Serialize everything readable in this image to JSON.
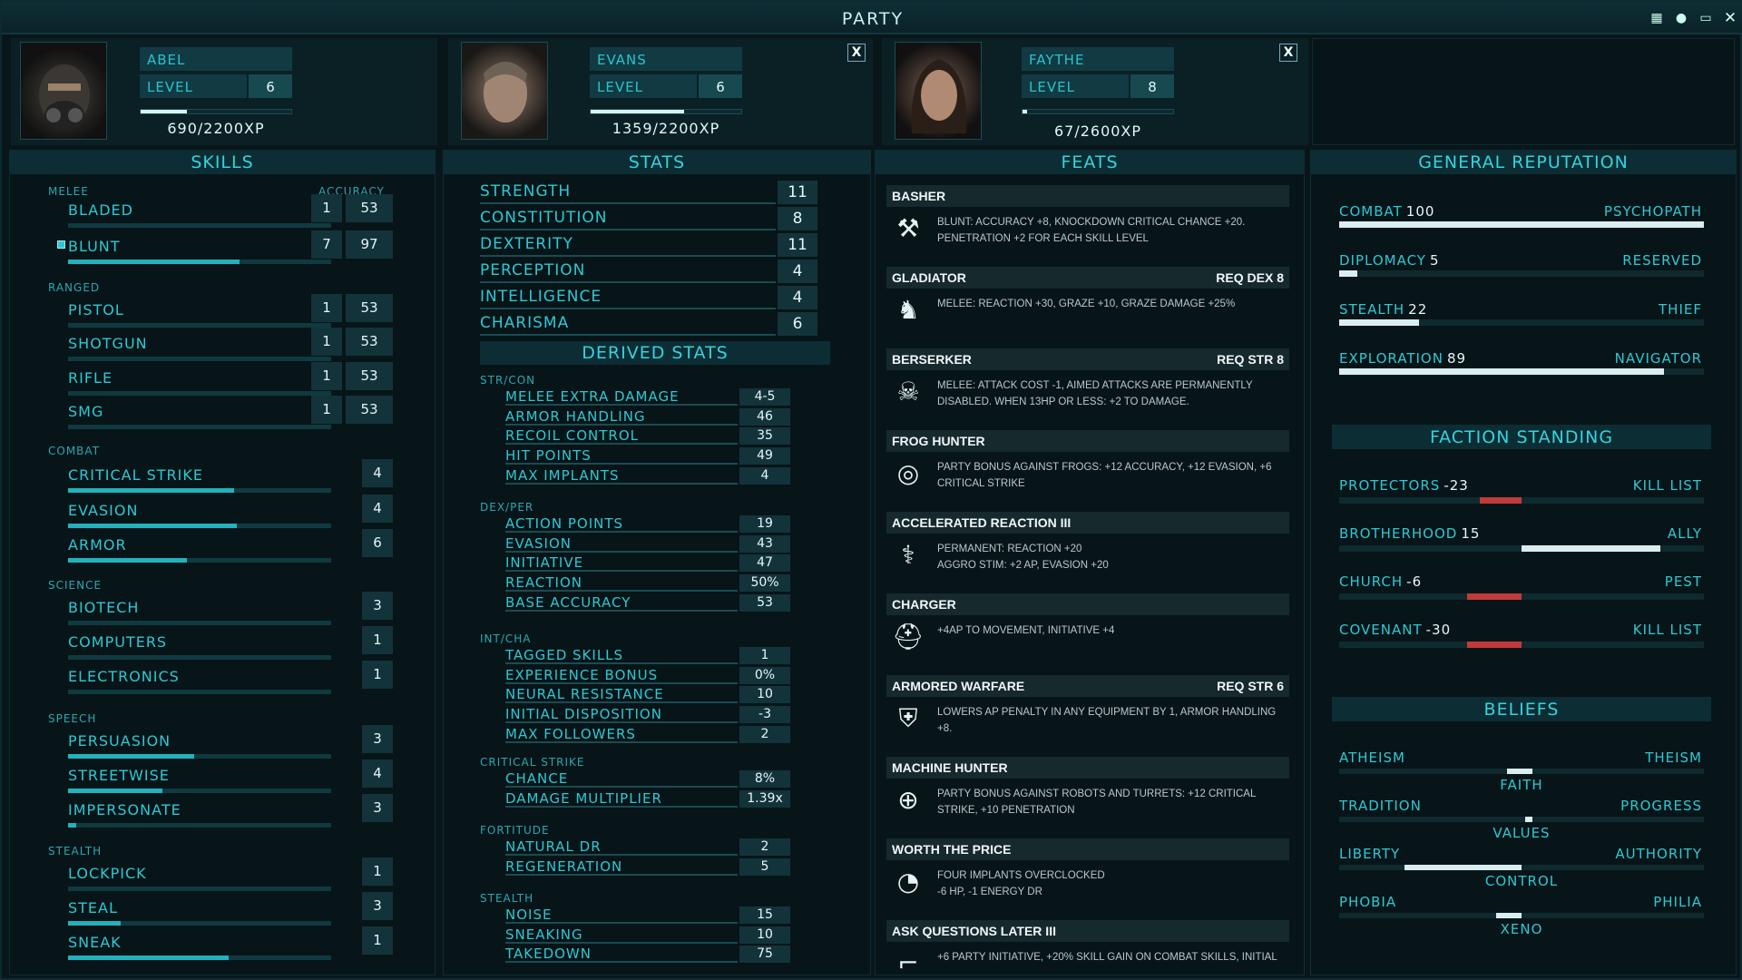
{
  "title": "PARTY",
  "chars": [
    {
      "name": "ABEL",
      "level_label": "LEVEL",
      "level": "6",
      "xp": "690/2200XP",
      "xp_frac": 0.31
    },
    {
      "name": "EVANS",
      "level_label": "LEVEL",
      "level": "6",
      "xp": "1359/2200XP",
      "xp_frac": 0.62
    },
    {
      "name": "FAYTHE",
      "level_label": "LEVEL",
      "level": "8",
      "xp": "67/2600XP",
      "xp_frac": 0.03
    }
  ],
  "close_label": "X",
  "headers": {
    "skills": "SKILLS",
    "stats": "STATS",
    "feats": "FEATS",
    "rep": "GENERAL REPUTATION",
    "derived": "DERIVED STATS",
    "faction": "FACTION STANDING",
    "beliefs": "BELIEFS"
  },
  "skills": {
    "melee": "MELEE",
    "accuracy": "ACCURACY",
    "ranged": "RANGED",
    "combat": "COMBAT",
    "science": "SCIENCE",
    "speech": "SPEECH",
    "stealth": "STEALTH",
    "items": [
      {
        "label": "BLADED",
        "lvl": "1",
        "acc": "53",
        "frac": 0
      },
      {
        "label": "BLUNT",
        "lvl": "7",
        "acc": "97",
        "frac": 0.65
      },
      {
        "label": "PISTOL",
        "lvl": "1",
        "acc": "53",
        "frac": 0
      },
      {
        "label": "SHOTGUN",
        "lvl": "1",
        "acc": "53",
        "frac": 0
      },
      {
        "label": "RIFLE",
        "lvl": "1",
        "acc": "53",
        "frac": 0
      },
      {
        "label": "SMG",
        "lvl": "1",
        "acc": "53",
        "frac": 0
      },
      {
        "label": "CRITICAL STRIKE",
        "lvl": "4",
        "frac": 0.63
      },
      {
        "label": "EVASION",
        "lvl": "4",
        "frac": 0.64
      },
      {
        "label": "ARMOR",
        "lvl": "6",
        "frac": 0.45
      },
      {
        "label": "BIOTECH",
        "lvl": "3",
        "frac": 0
      },
      {
        "label": "COMPUTERS",
        "lvl": "1",
        "frac": 0
      },
      {
        "label": "ELECTRONICS",
        "lvl": "1",
        "frac": 0
      },
      {
        "label": "PERSUASION",
        "lvl": "3",
        "frac": 0.48
      },
      {
        "label": "STREETWISE",
        "lvl": "4",
        "frac": 0.36
      },
      {
        "label": "IMPERSONATE",
        "lvl": "3",
        "frac": 0.03
      },
      {
        "label": "LOCKPICK",
        "lvl": "1",
        "frac": 0
      },
      {
        "label": "STEAL",
        "lvl": "3",
        "frac": 0.2
      },
      {
        "label": "SNEAK",
        "lvl": "1",
        "frac": 0.61
      }
    ]
  },
  "stats": [
    {
      "label": "STRENGTH",
      "value": "11"
    },
    {
      "label": "CONSTITUTION",
      "value": "8"
    },
    {
      "label": "DEXTERITY",
      "value": "11"
    },
    {
      "label": "PERCEPTION",
      "value": "4"
    },
    {
      "label": "INTELLIGENCE",
      "value": "4"
    },
    {
      "label": "CHARISMA",
      "value": "6"
    }
  ],
  "derived": [
    {
      "group": "STR/CON",
      "items": [
        {
          "label": "MELEE EXTRA DAMAGE",
          "value": "4-5"
        },
        {
          "label": "ARMOR HANDLING",
          "value": "46"
        },
        {
          "label": "RECOIL CONTROL",
          "value": "35"
        },
        {
          "label": "HIT POINTS",
          "value": "49"
        },
        {
          "label": "MAX IMPLANTS",
          "value": "4"
        }
      ]
    },
    {
      "group": "DEX/PER",
      "items": [
        {
          "label": "ACTION POINTS",
          "value": "19"
        },
        {
          "label": "EVASION",
          "value": "43"
        },
        {
          "label": "INITIATIVE",
          "value": "47"
        },
        {
          "label": "REACTION",
          "value": "50%"
        },
        {
          "label": "BASE ACCURACY",
          "value": "53"
        }
      ]
    },
    {
      "group": "INT/CHA",
      "items": [
        {
          "label": "TAGGED SKILLS",
          "value": "1"
        },
        {
          "label": "EXPERIENCE BONUS",
          "value": "0%"
        },
        {
          "label": "NEURAL RESISTANCE",
          "value": "10"
        },
        {
          "label": "INITIAL DISPOSITION",
          "value": "-3"
        },
        {
          "label": "MAX FOLLOWERS",
          "value": "2"
        }
      ]
    },
    {
      "group": "CRITICAL STRIKE",
      "items": [
        {
          "label": "CHANCE",
          "value": "8%"
        },
        {
          "label": "DAMAGE MULTIPLIER",
          "value": "1.39x"
        }
      ]
    },
    {
      "group": "FORTITUDE",
      "items": [
        {
          "label": "NATURAL DR",
          "value": "2"
        },
        {
          "label": "REGENERATION",
          "value": "5"
        }
      ]
    },
    {
      "group": "STEALTH",
      "items": [
        {
          "label": "NOISE",
          "value": "15"
        },
        {
          "label": "SNEAKING",
          "value": "10"
        },
        {
          "label": "TAKEDOWN",
          "value": "75"
        }
      ]
    }
  ],
  "feats": [
    {
      "name": "BASHER",
      "req": "",
      "icon": "hammer-wrench-icon",
      "glyph": "⚒",
      "desc": "BLUNT: ACCURACY +8, KNOCKDOWN CRITICAL CHANCE +20. PENETRATION +2 FOR EACH SKILL LEVEL"
    },
    {
      "name": "GLADIATOR",
      "req": "REQ DEX 8",
      "icon": "gladiator-icon",
      "glyph": "♞",
      "desc": "MELEE: REACTION +30, GRAZE +10, GRAZE DAMAGE +25%"
    },
    {
      "name": "BERSERKER",
      "req": "REQ STR 8",
      "icon": "skull-axes-icon",
      "glyph": "☠",
      "desc": "MELEE: ATTACK COST -1, AIMED ATTACKS ARE PERMANENTLY DISABLED. WHEN 13HP OR LESS: +2 TO DAMAGE."
    },
    {
      "name": "FROG HUNTER",
      "req": "",
      "icon": "frog-target-icon",
      "glyph": "◎",
      "desc": "PARTY BONUS AGAINST FROGS: +12 ACCURACY, +12 EVASION, +6 CRITICAL STRIKE"
    },
    {
      "name": "ACCELERATED REACTION III",
      "req": "",
      "icon": "dna-icon",
      "glyph": "⚕",
      "desc": "PERMANENT: REACTION +20\nAGGRO STIM: +2 AP, EVASION +20"
    },
    {
      "name": "CHARGER",
      "req": "",
      "icon": "helmet-icon",
      "glyph": "⛑",
      "desc": "+4AP TO MOVEMENT, INITIATIVE +4"
    },
    {
      "name": "ARMORED WARFARE",
      "req": "REQ STR 6",
      "icon": "armor-icon",
      "glyph": "⛨",
      "desc": "LOWERS AP PENALTY IN ANY EQUIPMENT BY 1, ARMOR HANDLING +8."
    },
    {
      "name": "MACHINE HUNTER",
      "req": "",
      "icon": "robot-target-icon",
      "glyph": "⊕",
      "desc": "PARTY BONUS AGAINST ROBOTS AND TURRETS: +12 CRITICAL STRIKE, +10 PENETRATION"
    },
    {
      "name": "WORTH THE PRICE",
      "req": "",
      "icon": "gauge-icon",
      "glyph": "◔",
      "desc": "FOUR IMPLANTS OVERCLOCKED\n-6 HP, -1 ENERGY DR"
    },
    {
      "name": "ASK QUESTIONS LATER III",
      "req": "",
      "icon": "gun-icon",
      "glyph": "⌐",
      "desc": "+6 PARTY INITIATIVE, +20% SKILL GAIN ON COMBAT SKILLS, INITIAL"
    }
  ],
  "reputation": [
    {
      "left": "COMBAT",
      "value": "100",
      "right": "PSYCHOPATH",
      "frac": 1.0
    },
    {
      "left": "DIPLOMACY",
      "value": "5",
      "right": "RESERVED",
      "frac": 0.05
    },
    {
      "left": "STEALTH",
      "value": "22",
      "right": "THIEF",
      "frac": 0.22
    },
    {
      "left": "EXPLORATION",
      "value": "89",
      "right": "NAVIGATOR",
      "frac": 0.89
    }
  ],
  "factions": [
    {
      "left": "PROTECTORS",
      "value": "-23",
      "right": "KILL LIST",
      "frac": -0.23,
      "color": "#c03b3b"
    },
    {
      "left": "BROTHERHOOD",
      "value": "15",
      "right": "ALLY",
      "frac": 0.76,
      "color": "#d8eef0"
    },
    {
      "left": "CHURCH",
      "value": "-6",
      "right": "PEST",
      "frac": -0.06,
      "color": "#c03b3b"
    },
    {
      "left": "COVENANT",
      "value": "-30",
      "right": "KILL LIST",
      "frac": -0.3,
      "color": "#c03b3b"
    }
  ],
  "beliefs": [
    {
      "left": "ATHEISM",
      "right": "THEISM",
      "label": "FAITH",
      "pos": 0.46,
      "width": 0.07
    },
    {
      "left": "TRADITION",
      "right": "PROGRESS",
      "label": "VALUES",
      "pos": 0.51,
      "width": 0.02
    },
    {
      "left": "LIBERTY",
      "right": "AUTHORITY",
      "label": "CONTROL",
      "pos": 0.18,
      "width": 0.32
    },
    {
      "left": "PHOBIA",
      "right": "PHILIA",
      "label": "XENO",
      "pos": 0.43,
      "width": 0.07
    }
  ]
}
